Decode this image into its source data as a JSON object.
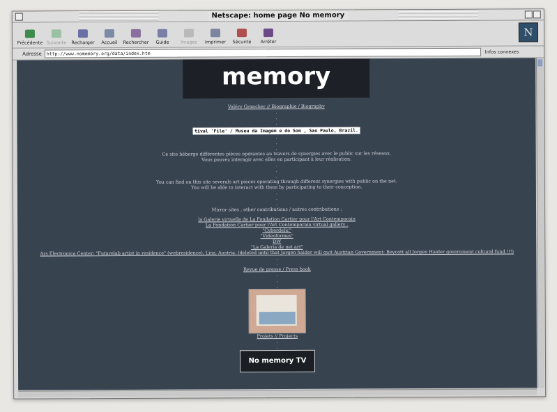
{
  "window": {
    "title": "Netscape: home page No memory"
  },
  "toolbar": {
    "buttons": [
      {
        "label": "Précédente"
      },
      {
        "label": "Suivante"
      },
      {
        "label": "Recharger"
      },
      {
        "label": "Accueil"
      },
      {
        "label": "Rechercher"
      },
      {
        "label": "Guide"
      },
      {
        "label": "Images"
      },
      {
        "label": "Imprimer"
      },
      {
        "label": "Sécurité"
      },
      {
        "label": "Arrêter"
      }
    ],
    "logo": "N"
  },
  "location": {
    "label": "Adresse",
    "url": "http://www.nomemory.org/data/index.htm",
    "info": "Infos connexes"
  },
  "page": {
    "heading": "memory",
    "author_link": "Valéry Grancher // Biographie / Biography",
    "banner": "tival 'File' / Museu da Imagem e do Som , Sao Paulo, Brazil.",
    "fr_line1": "Ce site héberge différentes pièces opérantes au travers de synergies avec le public sur les réseaux.",
    "fr_line2": "Vous pouvez interagir avec elles en participant à leur réalisation.",
    "en_line1": "You can find on this site severals art pieces operating through different synergies with public on the net.",
    "en_line2": "You will be able to interact with them by participating to their conception.",
    "mirror_heading": "Mirror sites , other contributions / autres contributions :",
    "links": [
      "la Galerie virtuelle de La Fondation Cartier pour l'Art Contemporain",
      "La Fondation Cartier pour l'Art Contemporain virtual gallery .",
      "\"Cyberdelic\"",
      "\"Videoformes\"",
      "DW",
      "\"La Galeria de net art\"",
      "Ars Electronica Center: \"Futurelab artist in residence\" (webresidence), Linz, Austria. (deleted until that Jorgen haider will quit Austrian Government: Boycott all Jorgen Haider government cultural fund !!!)"
    ],
    "press_link": "Revue de presse / Press book",
    "projects_link": "Projets // Projects",
    "tv_box": "No memory TV"
  }
}
